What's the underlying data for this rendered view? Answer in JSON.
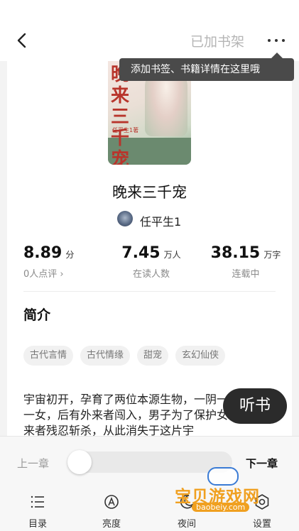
{
  "header": {
    "shelf_label": "已加书架",
    "tooltip": "添加书签、书籍详情在这里哦"
  },
  "book": {
    "cover_title": "晚来三千宠",
    "cover_author": "任平生1著",
    "title": "晚来三千宠",
    "author": "任平生1"
  },
  "stats": [
    {
      "value": "8.89",
      "unit": "分",
      "label": "0人点评 ›"
    },
    {
      "value": "7.45",
      "unit": "万人",
      "label": "在读人数"
    },
    {
      "value": "38.15",
      "unit": "万字",
      "label": "连载中"
    }
  ],
  "intro": {
    "heading": "简介",
    "tags": [
      "古代言情",
      "古代情缘",
      "甜宠",
      "玄幻仙侠"
    ],
    "description": "宇宙初开，孕育了两位本源生物，一阴一阳，一男一女，后有外来者闯入，男子为了保护女子，被外来者残忍斩杀，从此消失于这片宇"
  },
  "listen_button": "听书",
  "reader": {
    "prev_chapter": "上一章",
    "next_chapter": "下一章",
    "progress": 0.0,
    "tools": [
      {
        "label": "目录",
        "icon": "list-icon"
      },
      {
        "label": "亮度",
        "icon": "brightness-icon"
      },
      {
        "label": "夜间",
        "icon": "moon-icon"
      },
      {
        "label": "设置",
        "icon": "gear-icon"
      }
    ]
  },
  "watermark": {
    "text": "宝贝游戏网",
    "url": "baobeiy.com"
  },
  "colors": {
    "accent": "#2b2b2b",
    "watermark": "#f0a020"
  }
}
